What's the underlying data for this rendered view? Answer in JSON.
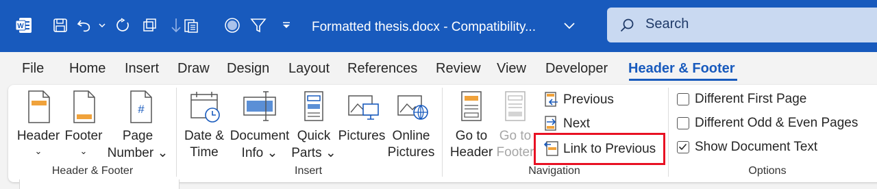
{
  "titlebar": {
    "app_icon": "word-logo-icon",
    "qat": [
      "save-icon",
      "undo-icon",
      "undo-dropdown-icon",
      "redo-icon",
      "copy-format-icon",
      "down-arrow-icon",
      "paste-icon",
      "record-icon",
      "filter-icon",
      "customize-dropdown-icon"
    ],
    "doc_title": "Formatted thesis.docx  -  Compatibility...",
    "search_placeholder": "Search"
  },
  "tabs": [
    "File",
    "Home",
    "Insert",
    "Draw",
    "Design",
    "Layout",
    "References",
    "Review",
    "View",
    "Developer",
    "Header & Footer"
  ],
  "active_tab": "Header & Footer",
  "ribbon": {
    "groups": {
      "header_footer": {
        "label": "Header & Footer",
        "header": {
          "line1": "Header",
          "chev": "⌄"
        },
        "footer": {
          "line1": "Footer",
          "chev": "⌄"
        },
        "page_number": {
          "line1": "Page",
          "line2": "Number ⌄"
        }
      },
      "insert": {
        "label": "Insert",
        "date_time": {
          "line1": "Date &",
          "line2": "Time"
        },
        "document_info": {
          "line1": "Document",
          "line2": "Info ⌄"
        },
        "quick_parts": {
          "line1": "Quick",
          "line2": "Parts ⌄"
        },
        "pictures": {
          "line1": "Pictures"
        },
        "online_pictures": {
          "line1": "Online",
          "line2": "Pictures"
        }
      },
      "navigation": {
        "label": "Navigation",
        "go_to_header": {
          "line1": "Go to",
          "line2": "Header"
        },
        "go_to_footer": {
          "line1": "Go to",
          "line2": "Footer"
        },
        "previous": "Previous",
        "next": "Next",
        "link_to_previous": "Link to Previous"
      },
      "options": {
        "label": "Options",
        "different_first_page": {
          "label": "Different First Page",
          "checked": false
        },
        "different_odd_even": {
          "label": "Different Odd & Even Pages",
          "checked": false
        },
        "show_document_text": {
          "label": "Show Document Text",
          "checked": true
        }
      }
    }
  },
  "colors": {
    "title_bar": "#185abd",
    "active_tab": "#185abd",
    "highlight": "#e81123",
    "accent_orange": "#f0a23b"
  }
}
